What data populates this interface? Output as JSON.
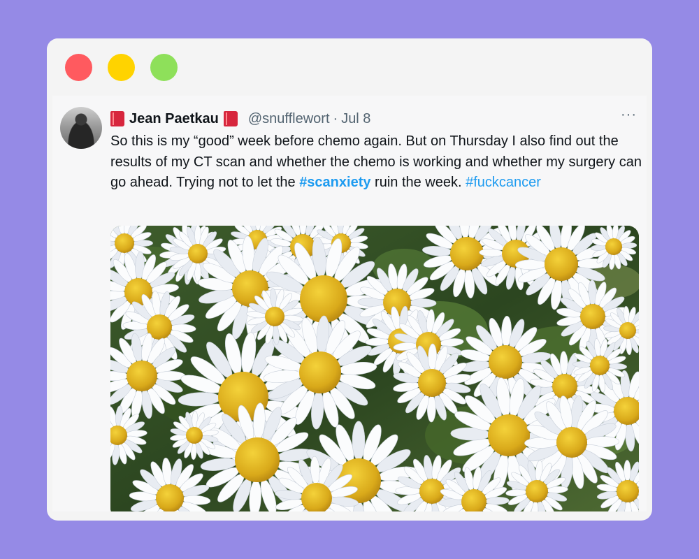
{
  "window": {
    "controls": [
      "close",
      "minimize",
      "maximize"
    ],
    "control_colors": {
      "close": "#ff5a5f",
      "minimize": "#ffd300",
      "maximize": "#8ee05a"
    },
    "background": "#958ae6"
  },
  "tweet": {
    "author_name": "Jean Paetkau",
    "name_emoji": "red-book-icon",
    "handle": "@snufflewort",
    "separator": "·",
    "date": "Jul 8",
    "more_label": "···",
    "text": {
      "part1": "So this is my “good” week before chemo again. But on Thursday I also find out the results of my CT scan and whether the chemo is working and whether my surgery can go ahead. Trying not to let the ",
      "hashtag1": "#scanxiety",
      "part2": " ruin the week. ",
      "hashtag2": "#fuckcancer"
    },
    "link_color": "#1d9bf0",
    "media": {
      "subject": "white daisy flowers with yellow centers"
    }
  }
}
